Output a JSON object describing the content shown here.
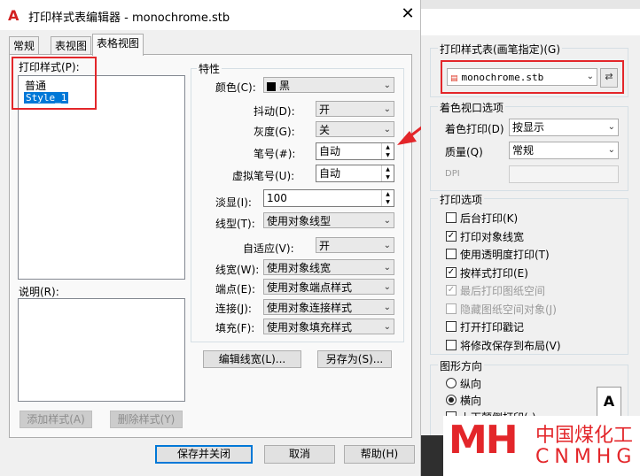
{
  "dialog": {
    "title": "打印样式表编辑器 - monochrome.stb",
    "app_icon": "autocad-icon",
    "tabs": [
      "常规",
      "表视图",
      "表格视图"
    ],
    "print_styles_label": "打印样式(P):",
    "styles": [
      "普通",
      "Style_1"
    ],
    "description_label": "说明(R):",
    "add_style_button": "添加样式(A)",
    "delete_style_button": "删除样式(Y)",
    "properties_group": "特性",
    "color_label": "颜色(C):",
    "color_value": "黑",
    "dither_label": "抖动(D):",
    "dither_value": "开",
    "grayscale_label": "灰度(G):",
    "grayscale_value": "关",
    "pen_label": "笔号(#):",
    "pen_value": "自动",
    "virtual_pen_label": "虚拟笔号(U):",
    "virtual_pen_value": "自动",
    "screening_label": "淡显(I):",
    "screening_value": "100",
    "linetype_label": "线型(T):",
    "linetype_value": "使用对象线型",
    "adaptive_label": "自适应(V):",
    "adaptive_value": "开",
    "lineweight_label": "线宽(W):",
    "lineweight_value": "使用对象线宽",
    "endstyle_label": "端点(E):",
    "endstyle_value": "使用对象端点样式",
    "joinstyle_label": "连接(J):",
    "joinstyle_value": "使用对象连接样式",
    "fillstyle_label": "填充(F):",
    "fillstyle_value": "使用对象填充样式",
    "edit_lineweights_button": "编辑线宽(L)...",
    "save_as_button": "另存为(S)...",
    "save_close_button": "保存并关闭",
    "cancel_button": "取消",
    "help_button": "帮助(H)"
  },
  "right_panel": {
    "plot_style_table_group": "打印样式表(画笔指定)(G)",
    "plot_style_value": "monochrome.stb",
    "shaded_viewport_group": "着色视口选项",
    "shade_plot_label": "着色打印(D)",
    "shade_plot_value": "按显示",
    "quality_label": "质量(Q)",
    "quality_value": "常规",
    "dpi_label": "DPI",
    "plot_options_group": "打印选项",
    "options": [
      {
        "label": "后台打印(K)",
        "checked": false,
        "disabled": false
      },
      {
        "label": "打印对象线宽",
        "checked": true,
        "disabled": false
      },
      {
        "label": "使用透明度打印(T)",
        "checked": false,
        "disabled": false
      },
      {
        "label": "按样式打印(E)",
        "checked": true,
        "disabled": false
      },
      {
        "label": "最后打印图纸空间",
        "checked": true,
        "disabled": true
      },
      {
        "label": "隐藏图纸空间对象(J)",
        "checked": false,
        "disabled": true
      },
      {
        "label": "打开打印戳记",
        "checked": false,
        "disabled": false
      },
      {
        "label": "将修改保存到布局(V)",
        "checked": false,
        "disabled": false
      }
    ],
    "orientation_group": "图形方向",
    "portrait_label": "纵向",
    "landscape_label": "横向",
    "upside_down_label": "上下颠倒打印(-)"
  },
  "watermark": {
    "cn": "中国煤化工",
    "en": "CNMHG",
    "logo": "MH"
  },
  "colors": {
    "annotation_red": "#e3262a",
    "selection_blue": "#0078d7",
    "watermark_red": "#e3262a"
  }
}
